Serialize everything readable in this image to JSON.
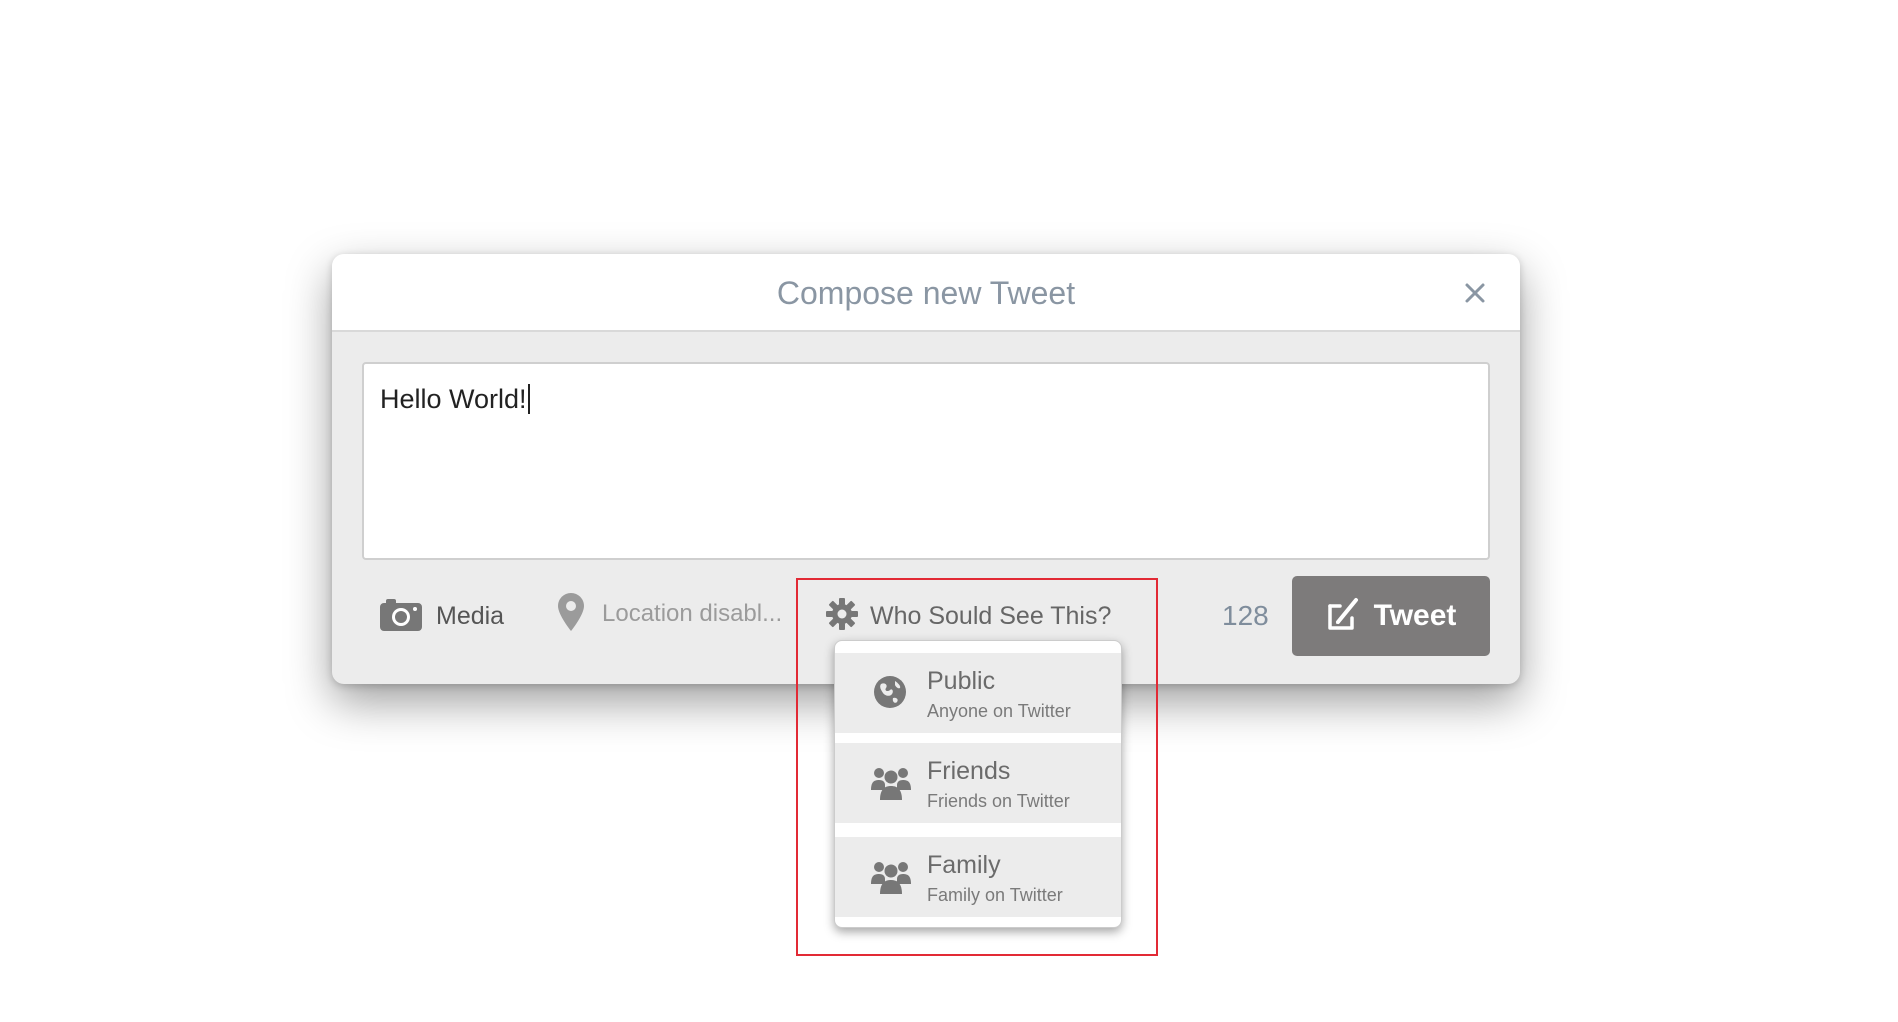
{
  "dialog": {
    "title": "Compose new Tweet",
    "close_icon": "close-icon"
  },
  "compose": {
    "text": "Hello World!"
  },
  "toolbar": {
    "media_label": "Media",
    "location_label": "Location disabl...",
    "privacy_label": "Who Sould See This?",
    "char_count": "128",
    "tweet_label": "Tweet"
  },
  "audience_menu": {
    "items": [
      {
        "title": "Public",
        "subtitle": "Anyone on Twitter",
        "icon": "globe-icon"
      },
      {
        "title": "Friends",
        "subtitle": "Friends on Twitter",
        "icon": "group-icon"
      },
      {
        "title": "Family",
        "subtitle": "Family on Twitter",
        "icon": "group-icon"
      }
    ]
  },
  "colors": {
    "icon_gray": "#777777",
    "tweet_button": "#7d7b7b",
    "highlight_border": "#e22a35",
    "title_color": "#8a96a3"
  }
}
